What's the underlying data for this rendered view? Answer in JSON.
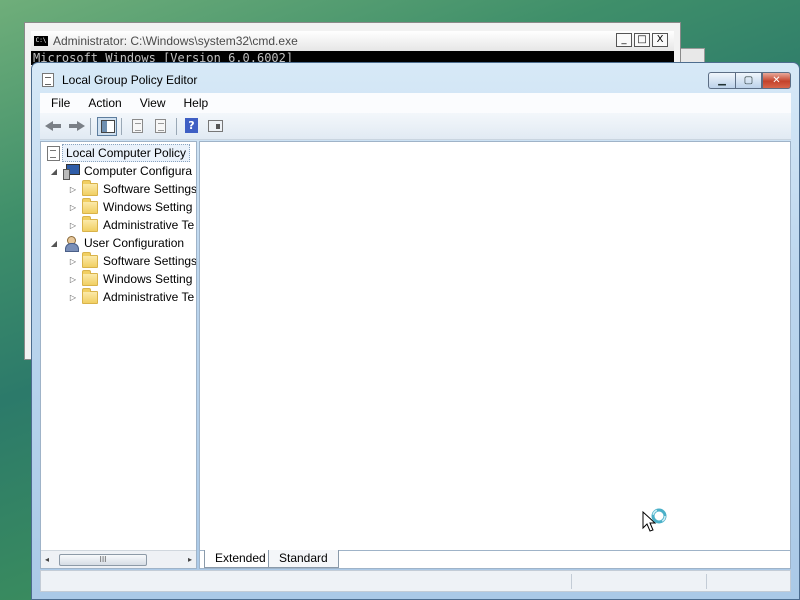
{
  "cmd_window": {
    "icon_text": "C:\\",
    "title": "Administrator: C:\\Windows\\system32\\cmd.exe",
    "console_line": "Microsoft Windows [Version 6.0.6002]",
    "min_glyph": "_",
    "max_glyph": "□",
    "close_glyph": "X"
  },
  "gpe_window": {
    "title": "Local Group Policy Editor",
    "min_glyph": "▁",
    "max_glyph": "▢",
    "close_glyph": "✕"
  },
  "menu": {
    "items": [
      "File",
      "Action",
      "View",
      "Help"
    ]
  },
  "toolbar": {
    "icons": [
      "back-arrow-icon",
      "forward-arrow-icon",
      "show-hide-tree-icon",
      "export-list-icon",
      "export-list-arrow-icon",
      "help-icon",
      "show-hide-action-pane-icon"
    ],
    "help_glyph": "?"
  },
  "tree": {
    "root": "Local Computer Policy",
    "computer_config": {
      "label": "Computer Configura",
      "children": [
        "Software Settings",
        "Windows Setting",
        "Administrative Te"
      ]
    },
    "user_config": {
      "label": "User Configuration",
      "children": [
        "Software Settings",
        "Windows Setting",
        "Administrative Te"
      ]
    }
  },
  "scrollbar": {
    "left_glyph": "◂",
    "right_glyph": "▸",
    "grip_glyph": "III"
  },
  "tabs": [
    "Extended",
    "Standard"
  ],
  "colors": {
    "close_button": "#c4432b",
    "selection_bg": "#eaf2fb",
    "folder": "#f1cf62"
  },
  "cursor": "busy-cursor-icon"
}
